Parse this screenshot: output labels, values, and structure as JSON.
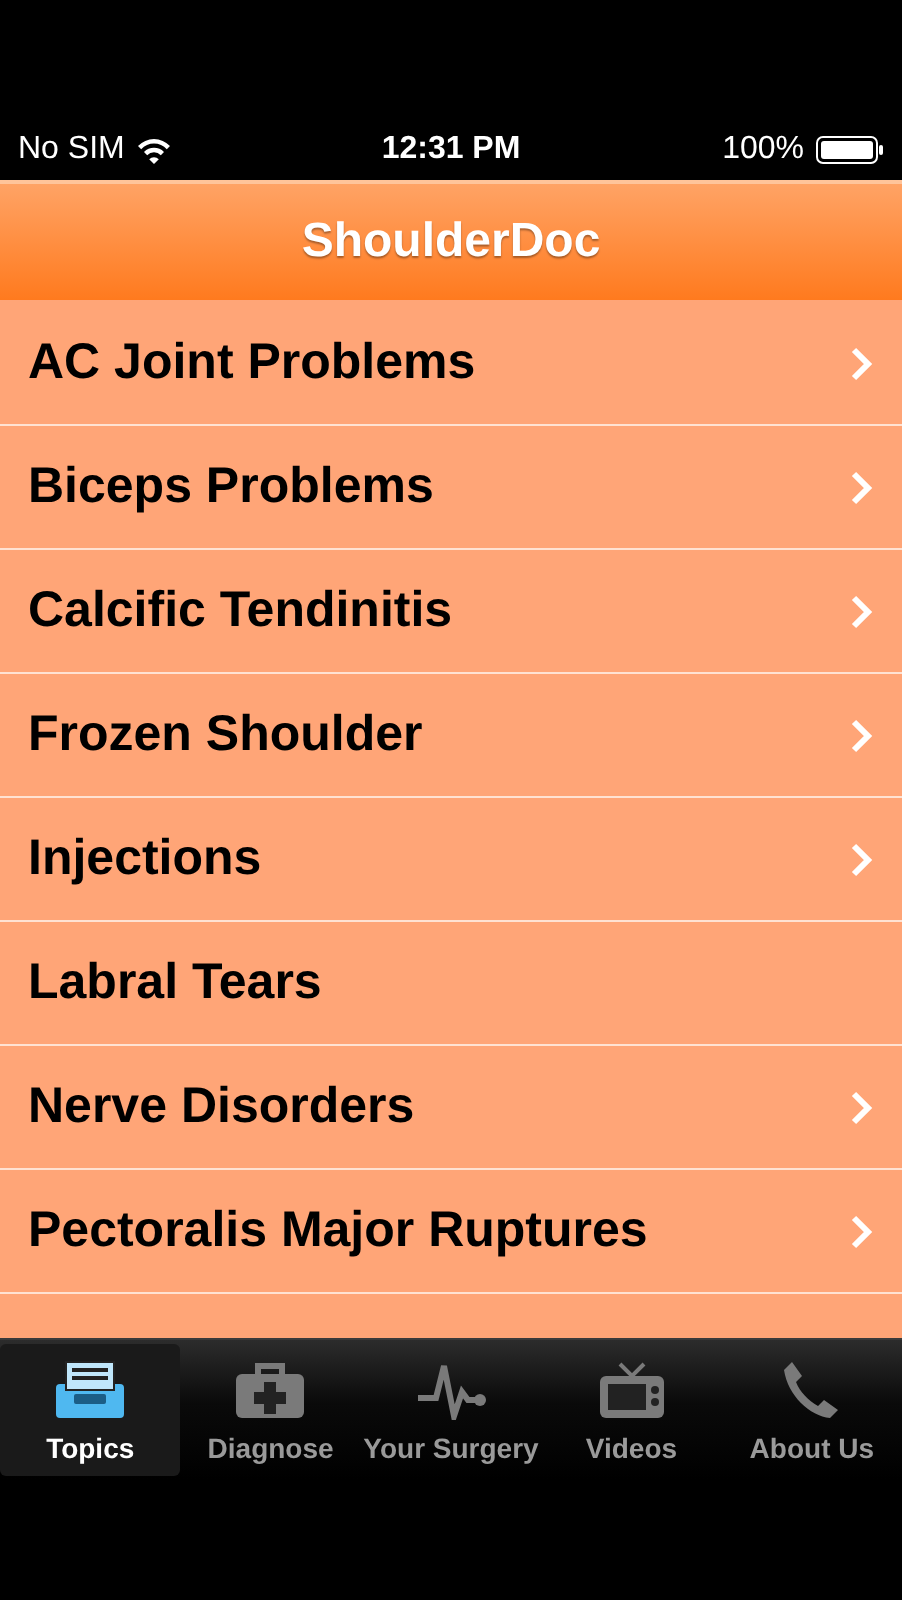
{
  "status_bar": {
    "carrier": "No SIM",
    "time": "12:31 PM",
    "battery": "100%"
  },
  "nav_bar": {
    "title": "ShoulderDoc"
  },
  "topics": [
    {
      "label": "AC Joint Problems",
      "chevron": true
    },
    {
      "label": "Biceps Problems",
      "chevron": true
    },
    {
      "label": "Calcific Tendinitis",
      "chevron": true
    },
    {
      "label": "Frozen Shoulder",
      "chevron": true
    },
    {
      "label": "Injections",
      "chevron": true
    },
    {
      "label": "Labral Tears",
      "chevron": false
    },
    {
      "label": "Nerve Disorders",
      "chevron": true
    },
    {
      "label": "Pectoralis Major Ruptures",
      "chevron": true
    }
  ],
  "tab_bar": [
    {
      "label": "Topics",
      "selected": true
    },
    {
      "label": "Diagnose",
      "selected": false
    },
    {
      "label": "Your Surgery",
      "selected": false
    },
    {
      "label": "Videos",
      "selected": false
    },
    {
      "label": "About Us",
      "selected": false
    }
  ]
}
